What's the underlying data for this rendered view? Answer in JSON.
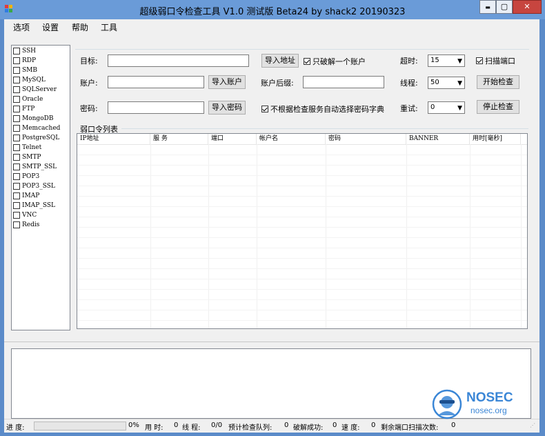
{
  "window": {
    "title": "超级弱口令检查工具 V1.0 测试版 Beta24 by shack2 20190323",
    "minimize": "▬",
    "maximize": "▢",
    "close": "✕"
  },
  "menu": [
    "选项",
    "设置",
    "帮助",
    "工具"
  ],
  "services": [
    "SSH",
    "RDP",
    "SMB",
    "MySQL",
    "SQLServer",
    "Oracle",
    "FTP",
    "MongoDB",
    "Memcached",
    "PostgreSQL",
    "Telnet",
    "SMTP",
    "SMTP_SSL",
    "POP3",
    "POP3_SSL",
    "IMAP",
    "IMAP_SSL",
    "VNC",
    "Redis"
  ],
  "form": {
    "target_label": "目标:",
    "account_label": "账户:",
    "password_label": "密码:",
    "import_address": "导入地址",
    "import_account": "导入账户",
    "import_password": "导入密码",
    "crack_one_label": "只破解一个账户",
    "crack_one_checked": true,
    "account_suffix_label": "账户后缀:",
    "no_auto_dict_label": "不根据检查服务自动选择密码字典",
    "no_auto_dict_checked": true,
    "timeout_label": "超时:",
    "timeout_value": "15",
    "threads_label": "线程:",
    "threads_value": "50",
    "retry_label": "重试:",
    "retry_value": "0",
    "scan_port_label": "扫描端口",
    "scan_port_checked": true,
    "start_button": "开始检查",
    "stop_button": "停止检查"
  },
  "list": {
    "title": "弱口令列表",
    "columns": [
      "IP地址",
      "服 务",
      "端口",
      "帐户名",
      "密码",
      "BANNER",
      "用时[毫秒]"
    ]
  },
  "status": {
    "progress_label": "进 度:",
    "progress_value": "0%",
    "progress_fraction": 0,
    "time_label": "用 时:",
    "time_value": "0",
    "threads_label": "线 程:",
    "threads_value": "0/0",
    "queue_label": "预计检查队列:",
    "queue_value": "0",
    "cracked_label": "破解成功:",
    "cracked_value": "0",
    "speed_label": "速 度:",
    "speed_value": "0",
    "remaining_label": "剩余端口扫描次数:",
    "remaining_value": "0"
  },
  "watermark": {
    "brand": "NOSEC",
    "domain": "nosec.org",
    "color": "#3a86d6"
  }
}
